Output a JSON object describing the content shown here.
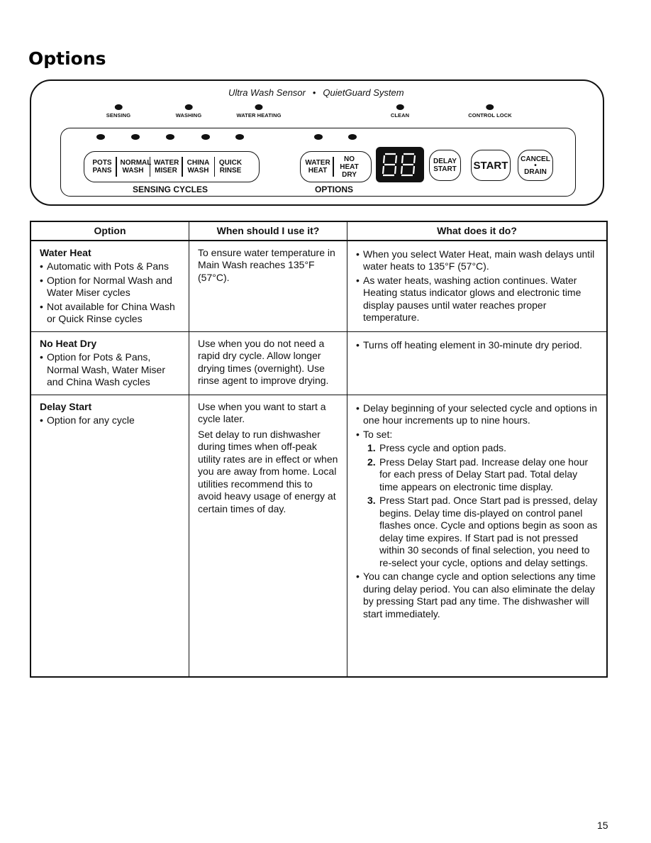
{
  "page": {
    "title": "Options",
    "page_number": "15"
  },
  "control_panel": {
    "brand_left": "Ultra Wash Sensor",
    "brand_sep": "•",
    "brand_right": "QuietGuard System",
    "status_indicators": [
      {
        "label": "SENSING"
      },
      {
        "label": "WASHING"
      },
      {
        "label": "WATER HEATING"
      },
      {
        "label": "CLEAN"
      },
      {
        "label": "CONTROL LOCK"
      }
    ],
    "sensing_cycles": {
      "label": "SENSING CYCLES",
      "pads": [
        {
          "label": "POTS\nPANS"
        },
        {
          "label": "NORMAL\nWASH"
        },
        {
          "label": "WATER\nMISER"
        },
        {
          "label": "CHINA\nWASH"
        },
        {
          "label": "QUICK\nRINSE"
        }
      ]
    },
    "options": {
      "label": "OPTIONS",
      "pads": [
        {
          "label": "WATER\nHEAT"
        },
        {
          "label": "NO HEAT\nDRY"
        }
      ]
    },
    "display": {
      "value": "88",
      "icon": "seven-segment-display"
    },
    "buttons": {
      "delay_start": "DELAY\nSTART",
      "start": "START",
      "cancel_drain": "CANCEL\n•\nDRAIN"
    }
  },
  "table": {
    "headers": [
      "Option",
      "When should I use it?",
      "What does it do?"
    ],
    "rows": [
      {
        "option": "Water Heat",
        "option_bullets": [
          "Automatic with Pots & Pans",
          "Option for Normal Wash and Water Miser cycles",
          "Not available for China Wash or Quick Rinse cycles"
        ],
        "when": [
          "To ensure water temperature in Main Wash reaches 135°F (57°C)."
        ],
        "what_bullets": [
          "When you select Water Heat, main wash delays until water heats to 135°F (57°C).",
          "As water heats, washing action continues. Water Heating status indicator glows and electronic time display pauses until water reaches proper temperature."
        ]
      },
      {
        "option": "No Heat Dry",
        "option_bullets": [
          "Option for Pots & Pans, Normal Wash, Water Miser and China Wash cycles"
        ],
        "when": [
          "Use when you do not need a rapid dry cycle. Allow longer drying times (overnight). Use rinse agent to improve drying."
        ],
        "what_bullets": [
          "Turns off heating element in 30-minute dry period."
        ]
      },
      {
        "option": "Delay Start",
        "option_bullets": [
          "Option for any cycle"
        ],
        "when": [
          "Use when you want to start a cycle later.",
          "Set delay to run dishwasher during times when off-peak utility rates are in effect or when you are away from home. Local utilities recommend this to avoid heavy usage of energy at certain times of day."
        ],
        "what_bullets": [
          "Delay beginning of your selected cycle and options in one hour increments up to nine hours.",
          "To set:",
          "You can change cycle and option selections any time during delay period. You can also eliminate the delay by pressing Start pad any time. The dishwasher will start immediately."
        ],
        "steps": [
          {
            "num": "1.",
            "text": "Press cycle and option pads."
          },
          {
            "num": "2.",
            "text": "Press Delay Start pad. Increase delay one hour for each press of Delay Start pad. Total delay time appears on electronic time display."
          },
          {
            "num": "3.",
            "text": "Press Start pad. Once Start pad is pressed, delay begins. Delay time dis-played on control panel flashes once. Cycle and options begin as soon as delay time expires. If Start pad is not pressed within 30 seconds of final selection, you need to re-select your cycle, options and delay settings."
          }
        ]
      }
    ]
  }
}
